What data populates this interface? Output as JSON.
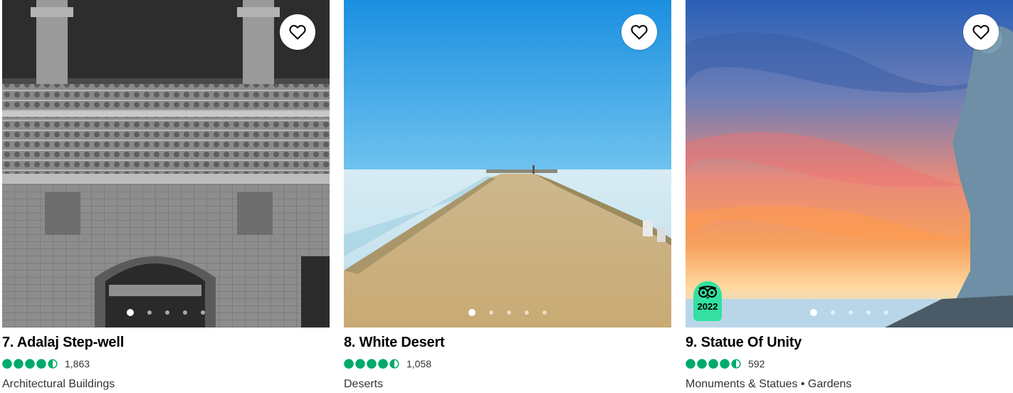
{
  "cards": [
    {
      "title": "7. Adalaj Step-well",
      "rating": 4.5,
      "reviews": "1,863",
      "category": "Architectural Buildings",
      "photo_dots": 5,
      "active_dot": 1,
      "saved": false,
      "award": null,
      "icons": [
        "heart-icon",
        "rating-bubbles"
      ]
    },
    {
      "title": "8. White Desert",
      "rating": 4.5,
      "reviews": "1,058",
      "category": "Deserts",
      "photo_dots": 5,
      "active_dot": 1,
      "saved": false,
      "award": null,
      "icons": [
        "heart-icon",
        "rating-bubbles"
      ]
    },
    {
      "title": "9. Statue Of Unity",
      "rating": 4.5,
      "reviews": "592",
      "category": "Monuments & Statues • Gardens",
      "photo_dots": 5,
      "active_dot": 1,
      "saved": false,
      "award": {
        "year": "2022",
        "icon": "travellers-choice-owl-icon"
      },
      "icons": [
        "heart-icon",
        "rating-bubbles"
      ]
    }
  ],
  "colors": {
    "bubble_green": "#00aa6c",
    "award_green": "#34e0a1",
    "text": "#000000",
    "muted": "#333333"
  }
}
